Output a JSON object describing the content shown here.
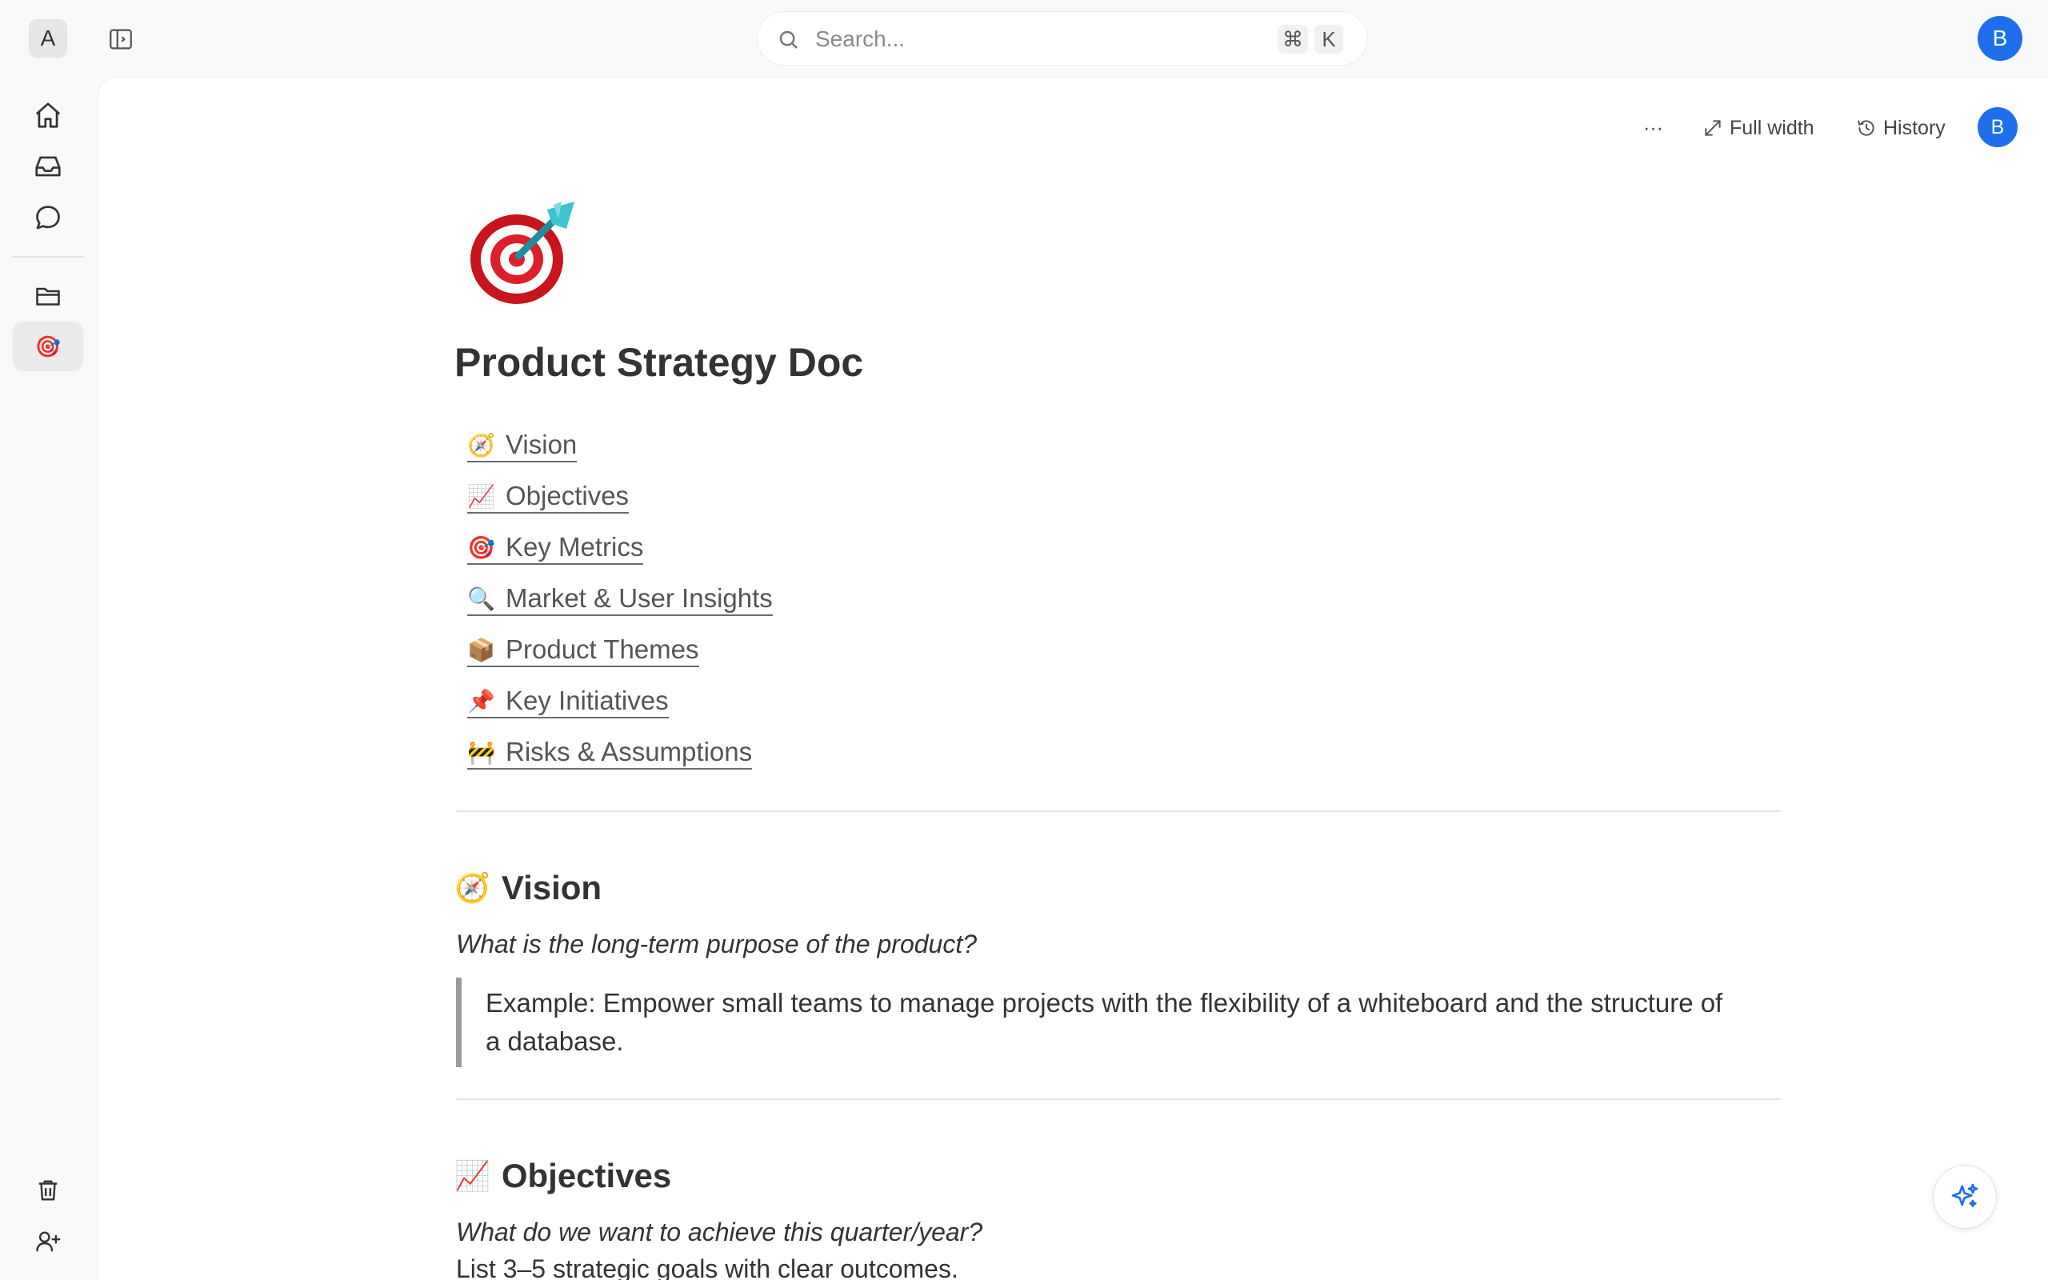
{
  "workspace": {
    "initial": "A"
  },
  "search": {
    "placeholder": "Search...",
    "shortcut_cmd": "⌘",
    "shortcut_key": "K"
  },
  "user": {
    "initial": "B"
  },
  "toolbar": {
    "more_label": "···",
    "full_width_label": "Full width",
    "history_label": "History"
  },
  "page": {
    "emoji": "🎯",
    "title": "Product Strategy Doc"
  },
  "toc": [
    {
      "emoji": "🧭",
      "label": "Vision"
    },
    {
      "emoji": "📈",
      "label": "Objectives"
    },
    {
      "emoji": "🎯",
      "label": "Key Metrics"
    },
    {
      "emoji": "🔍",
      "label": "Market & User Insights"
    },
    {
      "emoji": "📦",
      "label": "Product Themes"
    },
    {
      "emoji": "📌",
      "label": "Key Initiatives"
    },
    {
      "emoji": "🚧",
      "label": "Risks & Assumptions"
    }
  ],
  "sections": {
    "vision": {
      "emoji": "🧭",
      "heading": "Vision",
      "prompt": "What is the long-term purpose of the product?",
      "quote": "Example: Empower small teams to manage projects with the flexibility of a whiteboard and the structure of a database."
    },
    "objectives": {
      "emoji": "📈",
      "heading": "Objectives",
      "prompt": "What do we want to achieve this quarter/year?",
      "text": "List 3–5 strategic goals with clear outcomes."
    }
  },
  "colors": {
    "accent": "#1f6feb",
    "background": "#f9f9f9",
    "surface": "#ffffff"
  }
}
